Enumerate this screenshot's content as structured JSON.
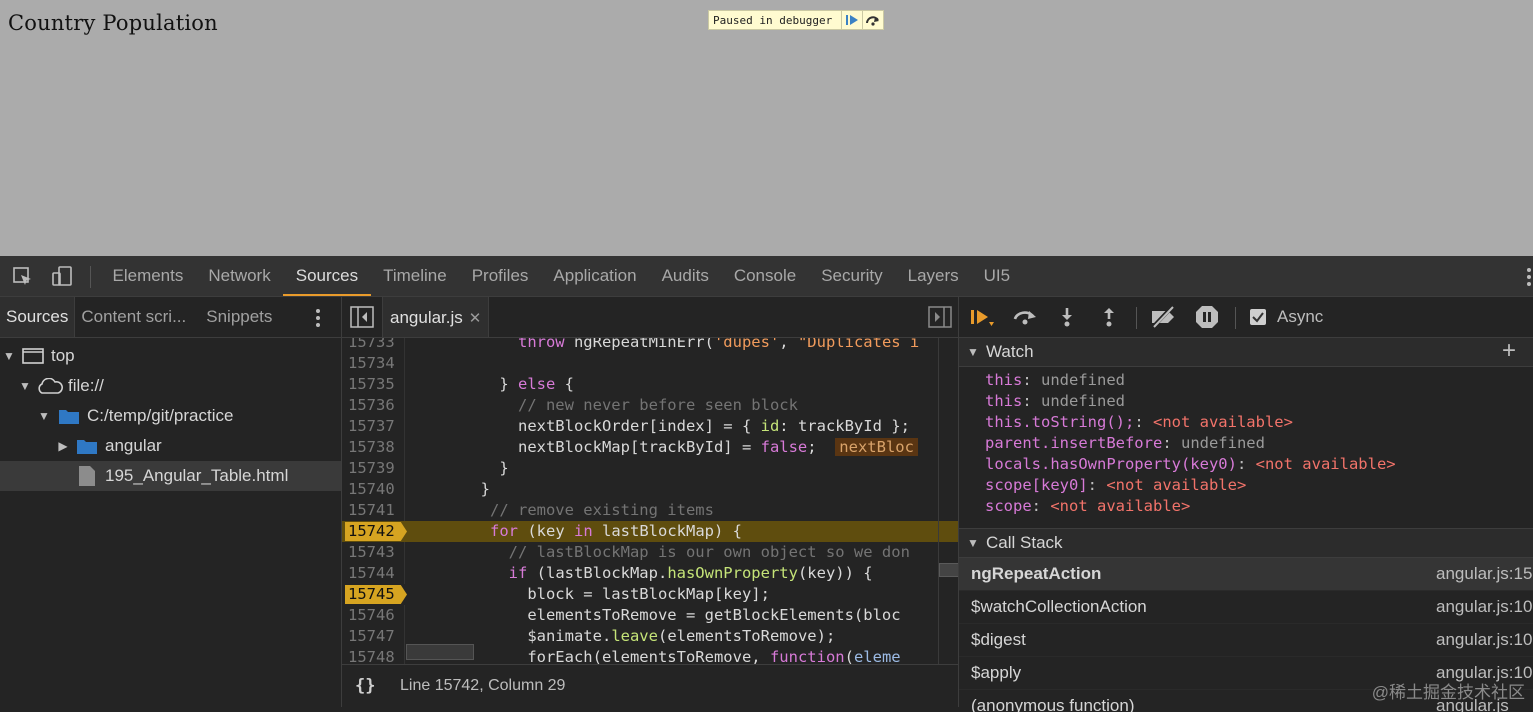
{
  "page": {
    "title": "Country Population"
  },
  "debugger_overlay": {
    "message": "Paused in debugger"
  },
  "devtools": {
    "tabs": [
      "Elements",
      "Network",
      "Sources",
      "Timeline",
      "Profiles",
      "Application",
      "Audits",
      "Console",
      "Security",
      "Layers",
      "UI5"
    ],
    "active_tab": "Sources"
  },
  "navigator": {
    "tabs": [
      "Sources",
      "Content scri...",
      "Snippets"
    ],
    "tree": [
      {
        "label": "top",
        "icon": "frame-icon",
        "expanded": true
      },
      {
        "label": "file://",
        "icon": "cloud-icon",
        "expanded": true
      },
      {
        "label": "C:/temp/git/practice",
        "icon": "folder-icon",
        "expanded": true
      },
      {
        "label": "angular",
        "icon": "folder-icon",
        "expanded": false
      },
      {
        "label": "195_Angular_Table.html",
        "icon": "file-icon",
        "selected": true
      }
    ]
  },
  "editor": {
    "file_tab": "angular.js",
    "lines": [
      {
        "num": "15733",
        "text": "            throw ngRepeatMinErr('dupes', \"Duplicates i"
      },
      {
        "num": "15734",
        "text": ""
      },
      {
        "num": "15735",
        "text": "          } else {"
      },
      {
        "num": "15736",
        "text": "            // new never before seen block"
      },
      {
        "num": "15737",
        "text": "            nextBlockOrder[index] = { id: trackById };"
      },
      {
        "num": "15738",
        "text": "            nextBlockMap[trackById] = false;",
        "inline": "nextBloc"
      },
      {
        "num": "15739",
        "text": "          }"
      },
      {
        "num": "15740",
        "text": "        }"
      },
      {
        "num": "15741",
        "text": "        // remove existing items"
      },
      {
        "num": "15742",
        "text": "        for (key in lastBlockMap) {",
        "breakpoint": true,
        "exec": true
      },
      {
        "num": "15743",
        "text": "          // lastBlockMap is our own object so we don"
      },
      {
        "num": "15744",
        "text": "          if (lastBlockMap.hasOwnProperty(key)) {"
      },
      {
        "num": "15745",
        "text": "            block = lastBlockMap[key];",
        "breakpoint": true
      },
      {
        "num": "15746",
        "text": "            elementsToRemove = getBlockElements(bloc"
      },
      {
        "num": "15747",
        "text": "            $animate.leave(elementsToRemove);"
      },
      {
        "num": "15748",
        "text": "            forEach(elementsToRemove, function(eleme"
      }
    ],
    "status": "Line 15742, Column 29",
    "pretty_print_icon": "{}"
  },
  "debugger": {
    "async_label": "Async",
    "async_checked": true,
    "watch_title": "Watch",
    "watch": [
      {
        "expr": "this",
        "value": "undefined",
        "available": true
      },
      {
        "expr": "this",
        "value": "undefined",
        "available": true
      },
      {
        "expr": "this.toString();",
        "value": "<not available>",
        "available": false
      },
      {
        "expr": "parent.insertBefore",
        "value": "undefined",
        "available": true
      },
      {
        "expr": "locals.hasOwnProperty(key0)",
        "value": "<not available>",
        "available": false
      },
      {
        "expr": "scope[key0]",
        "value": "<not available>",
        "available": false
      },
      {
        "expr": "scope",
        "value": "<not available>",
        "available": false
      }
    ],
    "callstack_title": "Call Stack",
    "callstack": [
      {
        "fn": "ngRepeatAction",
        "loc": "angular.js:15",
        "selected": true
      },
      {
        "fn": "$watchCollectionAction",
        "loc": "angular.js:10"
      },
      {
        "fn": "$digest",
        "loc": "angular.js:10"
      },
      {
        "fn": "$apply",
        "loc": "angular.js:10"
      },
      {
        "fn": "(anonymous function)",
        "loc": "angular.js"
      }
    ]
  },
  "watermark": "@稀土掘金技术社区",
  "colors": {
    "accent": "#e99b2b",
    "breakpoint": "#d6a421",
    "exec_line": "#5f4d0e"
  }
}
